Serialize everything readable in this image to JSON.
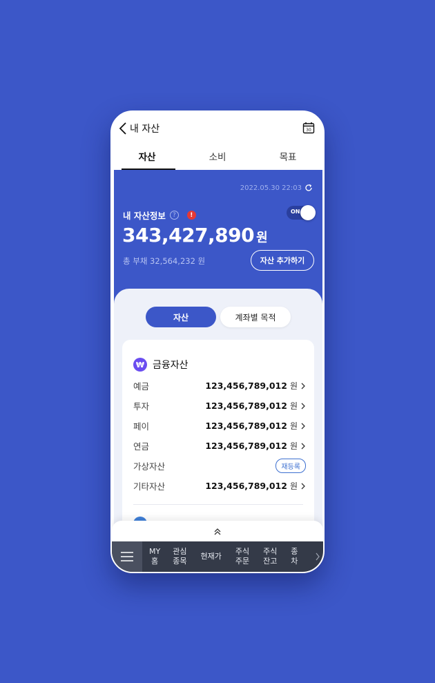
{
  "header": {
    "back_label": "내 자산",
    "calendar_day": "30"
  },
  "tabs": [
    {
      "label": "자산"
    },
    {
      "label": "소비"
    },
    {
      "label": "목표"
    }
  ],
  "hero": {
    "timestamp": "2022.05.30  22:03",
    "title": "내 자산정보",
    "help_glyph": "?",
    "alert_glyph": "!",
    "toggle_label": "ON",
    "toggle_on": true,
    "total_amount": "343,427,890",
    "total_unit": "원",
    "debt_text": "총 부채 32,564,232 원",
    "add_button": "자산 추가하기"
  },
  "segment": {
    "asset": "자산",
    "account_purpose": "계좌별 목적"
  },
  "card": {
    "icon_glyph": "₩",
    "title": "금융자산",
    "rows": [
      {
        "label": "예금",
        "value": "123,456,789,012",
        "unit": "원"
      },
      {
        "label": "투자",
        "value": "123,456,789,012",
        "unit": "원"
      },
      {
        "label": "페이",
        "value": "123,456,789,012",
        "unit": "원"
      },
      {
        "label": "연금",
        "value": "123,456,789,012",
        "unit": "원"
      },
      {
        "label": "가상자산",
        "badge": "재등록"
      },
      {
        "label": "기타자산",
        "value": "123,456,789,012",
        "unit": "원"
      }
    ]
  },
  "bottom_nav": {
    "items": [
      "MY\n홈",
      "관심\n종목",
      "현재가",
      "주식\n주문",
      "주식\n잔고",
      "종\n차"
    ]
  },
  "colors": {
    "brand": "#3c57c8",
    "alert": "#e53935",
    "nav_bg": "#343a48",
    "won_icon": "#6a4df0"
  }
}
